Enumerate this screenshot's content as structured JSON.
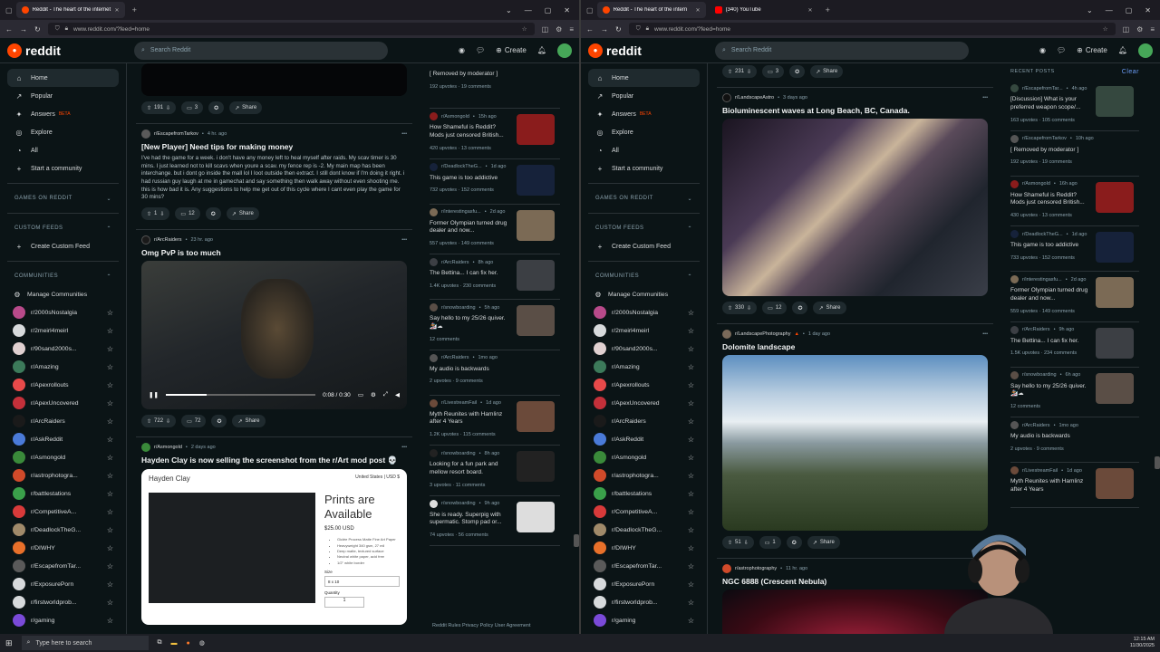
{
  "left": {
    "tabs": [
      {
        "title": "Reddit - The heart of the internet",
        "active": true
      }
    ],
    "url": "www.reddit.com/?feed=home",
    "feed": {
      "post1_actions": {
        "votes": "191",
        "comments": "3",
        "share": "Share"
      },
      "post2": {
        "sub": "r/EscapefromTarkov",
        "time": "4 hr. ago",
        "title": "[New Player] Need tips for making money",
        "body": "I've had the game for a week. i don't have any money left to heal myself after raids. My scav timer is 30 mins. I just learned not to kill scavs when youre a scav. my fence rep is -2. My main map has been interchange. but i dont go inside the mall lol I loot outside then extract. I still dont know if I'm doing it right. i had russian guy laugh at me in gamechat and say something then walk away without even shooting me. this is how bad it is. Any suggestions to help me get out of this cycle where I cant even play the game for 30 mins?",
        "votes": "1",
        "comments": "12",
        "share": "Share"
      },
      "post3": {
        "sub": "r/ArcRaiders",
        "time": "23 hr. ago",
        "title": "Omg PvP is too much",
        "video_time": "0:08 / 0:30",
        "votes": "722",
        "comments": "72",
        "share": "Share"
      },
      "post4": {
        "sub": "r/Asmongold",
        "time": "2 days ago",
        "title": "Hayden Clay is now selling the screenshot from the r/Art mod post 💀",
        "shop_name": "Hayden Clay",
        "shop_region": "United States | USD $",
        "prints": "Prints are Available",
        "price": "$25.00 USD",
        "size_label": "Size",
        "size_value": "8 x 10",
        "qty_label": "Quantity",
        "qty": "1",
        "bullets": [
          "Giclée Process Matte Fine Art Paper",
          "Heavyweight 340 gsm, 27 mil",
          "Deep matte, textured surface",
          "Neutral white paper, acid free",
          "1/2\" white border"
        ]
      }
    },
    "rail": [
      {
        "sub": "",
        "time": "",
        "title": "[ Removed by moderator ]",
        "stats": "192 upvotes · 19 comments",
        "thumb": ""
      },
      {
        "sub": "r/Asmongold",
        "time": "15h ago",
        "title": "How Shameful is Reddit? Mods just censored British...",
        "stats": "420 upvotes · 13 comments",
        "thumb": "#8a1c1c"
      },
      {
        "sub": "r/DeadlockTheG...",
        "time": "1d ago",
        "title": "This game is too addictive",
        "stats": "732 upvotes · 152 comments",
        "thumb": "#16223a"
      },
      {
        "sub": "r/interestingasfu...",
        "time": "2d ago",
        "title": "Former Olympian turned drug dealer and now...",
        "stats": "557 upvotes · 149 comments",
        "thumb": "#7b6a55"
      },
      {
        "sub": "r/ArcRaiders",
        "time": "8h ago",
        "title": "The Bettina... I can fix her.",
        "stats": "1.4K upvotes · 230 comments",
        "thumb": "#3c3f44"
      },
      {
        "sub": "r/snowboarding",
        "time": "5h ago",
        "title": "Say hello to my 25/26 quiver. 🏂☁",
        "stats": "12 comments",
        "thumb": "#5a4e46"
      },
      {
        "sub": "r/ArcRaiders",
        "time": "1mo ago",
        "title": "My audio is backwards",
        "stats": "2 upvotes · 9 comments",
        "thumb": ""
      },
      {
        "sub": "r/LivestreamFail",
        "time": "1d ago",
        "title": "Myth Reunites with Hamlinz after 4 Years",
        "stats": "1.2K upvotes · 115 comments",
        "thumb": "#6b4a3a"
      },
      {
        "sub": "r/snowboarding",
        "time": "8h ago",
        "title": "Looking for a fun park and mellow resort board.",
        "stats": "3 upvotes · 11 comments",
        "thumb": "#222"
      },
      {
        "sub": "r/snowboarding",
        "time": "9h ago",
        "title": "She is ready. Superpig with supermatic. Stomp pad or...",
        "stats": "74 upvotes · 56 comments",
        "thumb": "#ddd"
      }
    ],
    "footer": "Reddit Rules  Privacy Policy  User Agreement"
  },
  "right": {
    "tabs": [
      {
        "title": "Reddit - The heart of the intern",
        "active": true
      },
      {
        "title": "(340) YouTube",
        "active": false
      }
    ],
    "url": "www.reddit.com/?feed=home",
    "feed": {
      "post1_actions": {
        "votes": "231",
        "comments": "3",
        "share": "Share"
      },
      "post2": {
        "sub": "r/LandscapeAstro",
        "time": "3 days ago",
        "title": "Bioluminescent waves at Long Beach, BC, Canada.",
        "votes": "330",
        "comments": "12",
        "share": "Share"
      },
      "post3": {
        "sub": "r/LandscapePhotography",
        "time": "1 day ago",
        "title": "Dolomite landscape",
        "votes": "51",
        "comments": "1",
        "share": "Share"
      },
      "post4": {
        "sub": "r/astrophotography",
        "time": "11 hr. ago",
        "title": "NGC 6888 (Crescent Nebula)"
      }
    },
    "rail_head": "RECENT POSTS",
    "clear": "Clear",
    "rail": [
      {
        "sub": "r/EscapefromTar...",
        "time": "4h ago",
        "title": "[Discussion] What is your preferred weapon scope/...",
        "stats": "163 upvotes · 105 comments",
        "thumb": "#35483f"
      },
      {
        "sub": "r/EscapefromTarkov",
        "time": "10h ago",
        "title": "[ Removed by moderator ]",
        "stats": "192 upvotes · 19 comments",
        "thumb": ""
      },
      {
        "sub": "r/Asmongold",
        "time": "16h ago",
        "title": "How Shameful is Reddit? Mods just censored British...",
        "stats": "430 upvotes · 13 comments",
        "thumb": "#8a1c1c"
      },
      {
        "sub": "r/DeadlockTheG...",
        "time": "1d ago",
        "title": "This game is too addictive",
        "stats": "733 upvotes · 152 comments",
        "thumb": "#16223a"
      },
      {
        "sub": "r/interestingasfu...",
        "time": "2d ago",
        "title": "Former Olympian turned drug dealer and now...",
        "stats": "559 upvotes · 149 comments",
        "thumb": "#7b6a55"
      },
      {
        "sub": "r/ArcRaiders",
        "time": "9h ago",
        "title": "The Bettina... I can fix her.",
        "stats": "1.5K upvotes · 234 comments",
        "thumb": "#3c3f44"
      },
      {
        "sub": "r/snowboarding",
        "time": "6h ago",
        "title": "Say hello to my 25/26 quiver. 🏂☁",
        "stats": "12 comments",
        "thumb": "#5a4e46"
      },
      {
        "sub": "r/ArcRaiders",
        "time": "1mo ago",
        "title": "My audio is backwards",
        "stats": "2 upvotes · 9 comments",
        "thumb": ""
      },
      {
        "sub": "r/LivestreamFail",
        "time": "1d ago",
        "title": "Myth Reunites with Hamlinz after 4 Years",
        "stats": "",
        "thumb": "#6b4a3a"
      }
    ]
  },
  "reddit": {
    "logo": "reddit",
    "search": "Search Reddit",
    "create": "Create"
  },
  "sidebar": {
    "items": [
      {
        "label": "Home",
        "icon": "home-icon"
      },
      {
        "label": "Popular",
        "icon": "popular-icon"
      },
      {
        "label": "Answers",
        "icon": "answers-icon",
        "badge": "BETA"
      },
      {
        "label": "Explore",
        "icon": "explore-icon"
      },
      {
        "label": "All",
        "icon": "all-icon"
      },
      {
        "label": "Start a community",
        "icon": "plus-icon"
      }
    ],
    "games": "GAMES ON REDDIT",
    "custom": "CUSTOM FEEDS",
    "create_custom": "Create Custom Feed",
    "communities_head": "COMMUNITIES",
    "manage": "Manage Communities",
    "communities": [
      {
        "name": "r/2000sNostalgia",
        "color": "#b84a8a"
      },
      {
        "name": "r/2meirl4meirl",
        "color": "#d7dadc"
      },
      {
        "name": "r/90sand2000s...",
        "color": "#e0d0d0"
      },
      {
        "name": "r/Amazing",
        "color": "#3c7a5a"
      },
      {
        "name": "r/Apexrollouts",
        "color": "#e84a4a"
      },
      {
        "name": "r/ApexUncovered",
        "color": "#c4303a"
      },
      {
        "name": "r/ArcRaiders",
        "color": "#1a1a1a"
      },
      {
        "name": "r/AskReddit",
        "color": "#4a7ad8"
      },
      {
        "name": "r/Asmongold",
        "color": "#3a8a3a"
      },
      {
        "name": "r/astrophotogra...",
        "color": "#d04a2a"
      },
      {
        "name": "r/battlestations",
        "color": "#3aa04a"
      },
      {
        "name": "r/CompetitiveA...",
        "color": "#d83a3a"
      },
      {
        "name": "r/DeadlockTheG...",
        "color": "#a08a6a"
      },
      {
        "name": "r/DIWHY",
        "color": "#e8702a"
      },
      {
        "name": "r/EscapefromTar...",
        "color": "#5a5a5a"
      },
      {
        "name": "r/ExposurePorn",
        "color": "#d7dadc"
      },
      {
        "name": "r/firstworldprob...",
        "color": "#d7dadc"
      },
      {
        "name": "r/gaming",
        "color": "#7a4ad8"
      }
    ]
  },
  "taskbar": {
    "search": "Type here to search",
    "time": "12:15 AM",
    "date": "11/30/2025"
  }
}
